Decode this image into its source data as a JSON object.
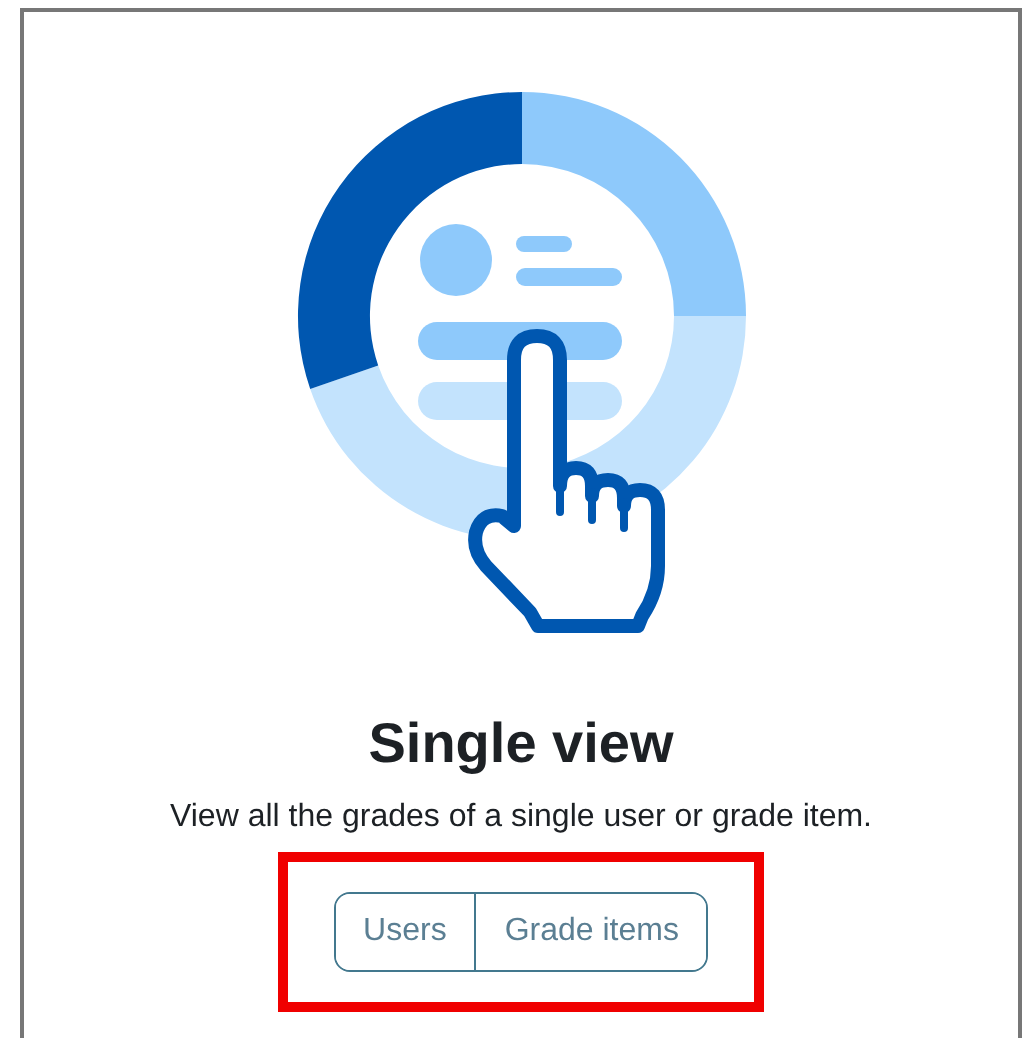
{
  "title": "Single view",
  "description": "View all the grades of a single user or grade item.",
  "buttons": [
    {
      "label": "Users"
    },
    {
      "label": "Grade items"
    }
  ]
}
